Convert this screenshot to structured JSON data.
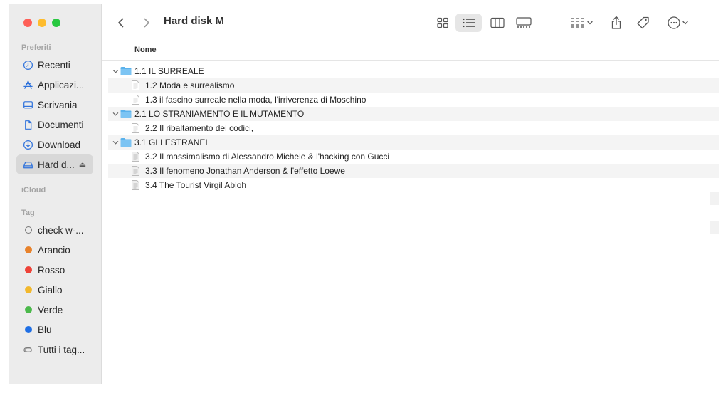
{
  "window": {
    "title": "Hard disk M"
  },
  "sidebar": {
    "sections": {
      "favorites": "Preferiti",
      "icloud": "iCloud",
      "tags": "Tag"
    },
    "favorites": [
      {
        "label": "Recenti",
        "icon": "clock-icon"
      },
      {
        "label": "Applicazi...",
        "icon": "applications-icon"
      },
      {
        "label": "Scrivania",
        "icon": "desktop-icon"
      },
      {
        "label": "Documenti",
        "icon": "document-icon"
      },
      {
        "label": "Download",
        "icon": "download-icon"
      },
      {
        "label": "Hard d...",
        "icon": "hard-disk-icon",
        "selected": true
      }
    ],
    "tags": [
      {
        "label": "check w-...",
        "color": ""
      },
      {
        "label": "Arancio",
        "color": "#e8822b"
      },
      {
        "label": "Rosso",
        "color": "#ee4238"
      },
      {
        "label": "Giallo",
        "color": "#f2b82d"
      },
      {
        "label": "Verde",
        "color": "#4bb94b"
      },
      {
        "label": "Blu",
        "color": "#1f6fe5"
      },
      {
        "label": "Tutti i tag...",
        "color": ""
      }
    ]
  },
  "toolbar": {
    "back_icon": "chevron-left-icon",
    "forward_icon": "chevron-right-icon",
    "views": [
      "icon-view-icon",
      "list-view-icon",
      "column-view-icon",
      "gallery-view-icon"
    ],
    "active_view": "list-view-icon",
    "actions": [
      "group-icon",
      "share-icon",
      "tag-icon",
      "more-icon"
    ]
  },
  "list": {
    "column_name": "Nome",
    "rows": [
      {
        "label": "1.1 IL SURREALE",
        "type": "folder",
        "expanded": true
      },
      {
        "label": "1.2 Moda e surrealismo",
        "type": "file"
      },
      {
        "label": "1.3 il fascino surreale nella moda, l'irriverenza di Moschino",
        "type": "file"
      },
      {
        "label": "2.1 LO STRANIAMENTO E IL MUTAMENTO",
        "type": "folder",
        "expanded": true
      },
      {
        "label": "2.2 Il ribaltamento dei codici,",
        "type": "file"
      },
      {
        "label": "3.1 GLI ESTRANEI",
        "type": "folder",
        "expanded": true
      },
      {
        "label": "3.2 Il massimalismo di Alessandro Michele & l'hacking con Gucci",
        "type": "file"
      },
      {
        "label": "3.3 Il fenomeno Jonathan Anderson & l'effetto Loewe",
        "type": "file"
      },
      {
        "label": "3.4 The Tourist Virgil Abloh",
        "type": "file"
      }
    ]
  }
}
